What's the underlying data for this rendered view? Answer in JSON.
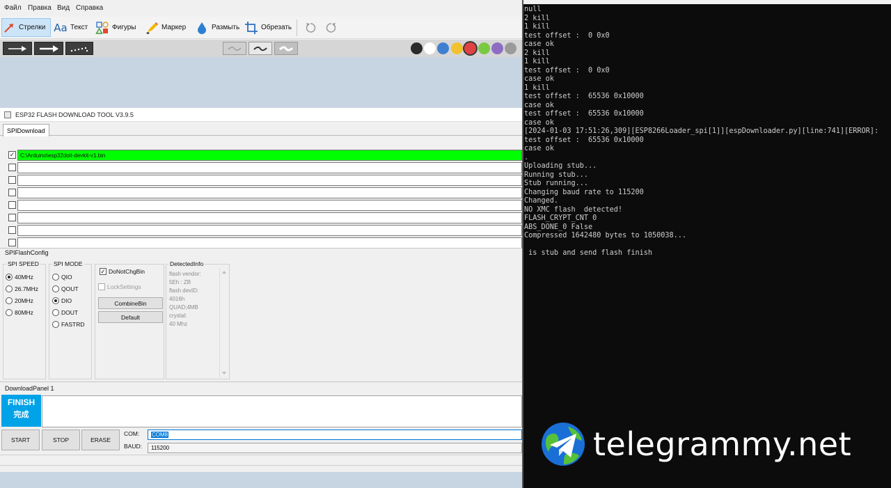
{
  "snip": {
    "menu": [
      "Файл",
      "Правка",
      "Вид",
      "Справка"
    ],
    "tools": {
      "arrows": "Стрелки",
      "text": "Текст",
      "shapes": "Фигуры",
      "marker": "Маркер",
      "blur": "Размыть",
      "crop": "Обрезать"
    },
    "palette": [
      "#2b2b2b",
      "#ffffff",
      "#3f7fd0",
      "#f2c12e",
      "#e04343",
      "#7ac943",
      "#8e6cc4",
      "#9a9a9a"
    ],
    "selected_color": "#e04343"
  },
  "esp": {
    "title": "ESP32 FLASH DOWNLOAD TOOL V3.9.5",
    "tab": "SPIDownload",
    "files": [
      {
        "checked": "✓",
        "path": "C:\\Arduino\\esp32doit-devkit-v1.bin"
      },
      {
        "checked": "",
        "path": ""
      },
      {
        "checked": "",
        "path": ""
      },
      {
        "checked": "",
        "path": ""
      },
      {
        "checked": "",
        "path": ""
      },
      {
        "checked": "",
        "path": ""
      },
      {
        "checked": "",
        "path": ""
      },
      {
        "checked": "",
        "path": ""
      }
    ],
    "flashconfig_label": "SPIFlashConfig",
    "spi_speed": {
      "label": "SPI SPEED",
      "options": [
        "40MHz",
        "26.7MHz",
        "20MHz",
        "80MHz"
      ],
      "selected": "40MHz"
    },
    "spi_mode": {
      "label": "SPI MODE",
      "options": [
        "QIO",
        "QOUT",
        "DIO",
        "DOUT",
        "FASTRD"
      ],
      "selected": "DIO"
    },
    "do_not_chg_bin": "DoNotChgBin",
    "do_not_chg_bin_check": "✓",
    "lock_settings": "LockSettings",
    "combine_bin": "CombineBin",
    "default_btn": "Default",
    "detected_label": "DetectedInfo",
    "detected_info": "flash vendor:\n5Eh : ZB\nflash devID:\n4016h\nQUAD;4MB\ncrystal:\n40 Mhz",
    "download_panel": "DownloadPanel 1",
    "finish_en": "FINISH",
    "finish_cn": "完成",
    "start": "START",
    "stop": "STOP",
    "erase": "ERASE",
    "com_label": "COM:",
    "com_value": "COM8",
    "baud_label": "BAUD:",
    "baud_value": "115200"
  },
  "console": {
    "lines": "null\n2 kill\n1 kill\ntest offset :  0 0x0\ncase ok\n2 kill\n1 kill\ntest offset :  0 0x0\ncase ok\n1 kill\ntest offset :  65536 0x10000\ncase ok\ntest offset :  65536 0x10000\ncase ok\n[2024-01-03 17:51:26,309][ESP8266Loader_spi[1]][espDownloader.py][line:741][ERROR]:\ntest offset :  65536 0x10000\ncase ok\n.\nUploading stub...\nRunning stub...\nStub running...\nChanging baud rate to 115200\nChanged.\nNO XMC flash  detected!\nFLASH_CRYPT_CNT 0\nABS_DONE_0 False\nCompressed 1642480 bytes to 1050038...\n\n is stub and send flash finish"
  },
  "watermark": {
    "text": "telegrammy.net"
  }
}
